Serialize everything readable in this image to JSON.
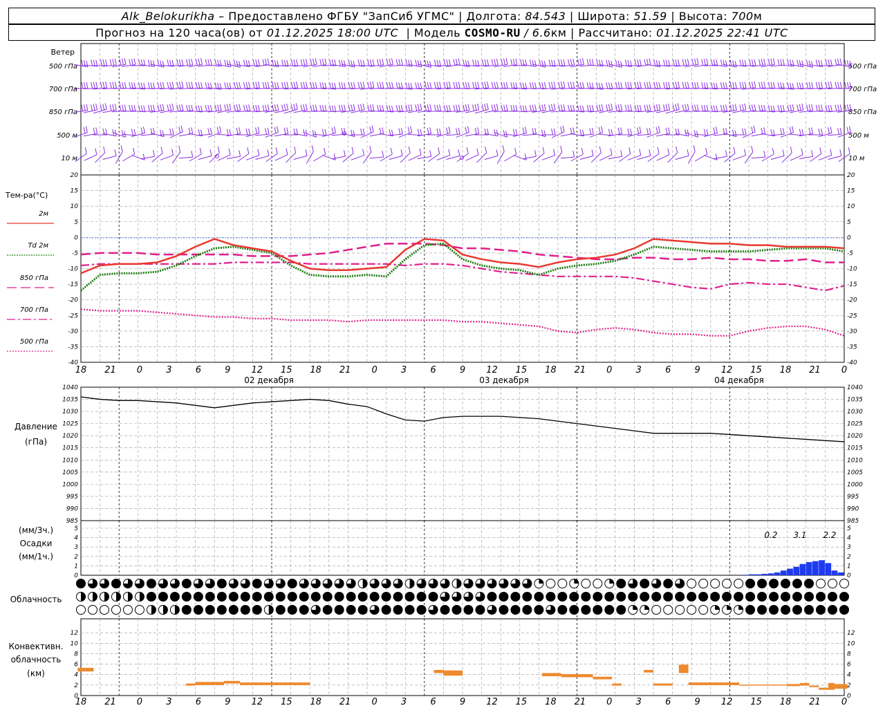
{
  "header": {
    "line1": {
      "station": "Alk_Belokurikha",
      "provider_text": " – Предоставлено ФГБУ \"ЗапСиб УГМС\" | Долгота: ",
      "lon": "84.543",
      "lat_label": " | Широта: ",
      "lat": "51.59",
      "alt_label": " | Высота: ",
      "alt": "700",
      "alt_unit": "м"
    },
    "line2": {
      "prefix": "Прогноз на 120 часа(ов) от ",
      "start": "01.12.2025 18:00 UTC",
      "model_label": "  | Модель ",
      "model": "COSMO-RU",
      "model_res": " / 6.6",
      "res_unit": "км",
      "calc_label": " | Рассчитано: ",
      "calc": "01.12.2025 22:41 UTC"
    }
  },
  "wind_panel": {
    "title": "Ветер",
    "levels": [
      "500 гПа",
      "700 гПа",
      "850 гПа",
      "500 м",
      "10 м"
    ],
    "color": "#8a2be2"
  },
  "time_axis": {
    "hour_labels": [
      "18",
      "21",
      "0",
      "3",
      "6",
      "9",
      "12",
      "15",
      "18",
      "21",
      "0",
      "3",
      "6",
      "9",
      "12",
      "15",
      "18",
      "21",
      "0",
      "3",
      "6",
      "9",
      "12",
      "15",
      "18",
      "21",
      "0"
    ],
    "day_labels": [
      "02 декабря",
      "03 декабря",
      "04 декабря"
    ]
  },
  "temp_panel": {
    "title": "Тем-ра(°C)",
    "legend": [
      {
        "label": "2м",
        "color": "#e8382f",
        "style": "solid"
      },
      {
        "label": "Td 2м",
        "color": "#1e7d12",
        "style": "dotted"
      },
      {
        "label": "850 гПа",
        "color": "#e01e8c",
        "style": "dash"
      },
      {
        "label": "700 гПа",
        "color": "#e01e8c",
        "style": "dashdot"
      },
      {
        "label": "500 гПа",
        "color": "#e01e8c",
        "style": "dot"
      }
    ],
    "y_ticks": [
      "20",
      "15",
      "10",
      "5",
      "0",
      "-5",
      "-10",
      "-15",
      "-20",
      "-25",
      "-30",
      "-35",
      "-40"
    ]
  },
  "pressure_panel": {
    "title": "Давление",
    "unit": "(гПа)",
    "y_ticks": [
      "1040",
      "1035",
      "1030",
      "1025",
      "1020",
      "1015",
      "1010",
      "1005",
      "1000",
      "995",
      "990",
      "985"
    ]
  },
  "precip_panel": {
    "unit3": "(мм/3ч.)",
    "title": "Осадки",
    "unit1": "(мм/1ч.)",
    "y_ticks": [
      "5",
      "4",
      "3",
      "2",
      "1",
      "0"
    ],
    "totals": [
      {
        "value": "0.2"
      },
      {
        "value": "3.1"
      },
      {
        "value": "2.2"
      }
    ],
    "color": "#1f3bf0"
  },
  "cloud_panel": {
    "title": "Облачность"
  },
  "conv_panel": {
    "title_line1": "Конвективн.",
    "title_line2": "облачность",
    "unit": "(км)",
    "y_ticks": [
      "12",
      "10",
      "8",
      "6",
      "4",
      "2",
      "0"
    ],
    "color": "#ee8a2e"
  },
  "chart_data": [
    {
      "type": "line",
      "title": "Тем-ра(°C)",
      "x_hours": [
        0,
        3,
        6,
        9,
        12,
        15,
        18,
        21,
        24,
        27,
        30,
        33,
        36,
        39,
        42,
        45,
        48,
        51,
        54,
        57,
        60,
        63,
        66,
        69,
        72,
        75,
        78,
        81,
        84,
        87,
        90,
        93,
        96,
        99,
        102,
        105,
        108,
        111,
        114,
        117,
        120
      ],
      "ylim": [
        -40,
        20
      ],
      "series": [
        {
          "name": "2м",
          "values": [
            -11.5,
            -9,
            -8.5,
            -8.5,
            -8,
            -6,
            -3,
            -0.5,
            -2.5,
            -3.5,
            -4.5,
            -7.5,
            -10,
            -10.5,
            -10.5,
            -10,
            -9.5,
            -4,
            -0.5,
            -1,
            -5.5,
            -7,
            -8,
            -8.5,
            -9.5,
            -8,
            -7,
            -6.5,
            -5.5,
            -3.5,
            -0.5,
            -1,
            -1.5,
            -2,
            -2,
            -2.5,
            -2.5,
            -3,
            -3,
            -3,
            -3.5
          ]
        },
        {
          "name": "Td 2м",
          "values": [
            -17,
            -12,
            -11.5,
            -11.5,
            -11,
            -9,
            -6,
            -3.5,
            -3,
            -4,
            -5,
            -9,
            -12,
            -12.5,
            -12.5,
            -12,
            -12.5,
            -7,
            -2.5,
            -2,
            -7,
            -9,
            -10,
            -10.5,
            -12,
            -10,
            -9,
            -8.5,
            -7.5,
            -5.5,
            -3,
            -3.5,
            -4,
            -4.5,
            -4.5,
            -4.5,
            -4,
            -3.5,
            -3.5,
            -3.5,
            -4.5
          ]
        },
        {
          "name": "850 гПа",
          "values": [
            -5.5,
            -5,
            -5,
            -5,
            -5.5,
            -5.5,
            -5.5,
            -5.5,
            -5.5,
            -6,
            -6,
            -6,
            -5.5,
            -5,
            -4,
            -3,
            -2,
            -2,
            -2,
            -2.5,
            -3.5,
            -3.5,
            -4,
            -4.5,
            -5.5,
            -6,
            -6.5,
            -7,
            -7,
            -6.5,
            -6.5,
            -7,
            -7,
            -6.5,
            -7,
            -7,
            -7.5,
            -7.5,
            -7,
            -8,
            -8
          ]
        },
        {
          "name": "700 гПа",
          "values": [
            -9,
            -8.5,
            -8.5,
            -8.5,
            -8.5,
            -8.5,
            -8.5,
            -8.5,
            -8,
            -8,
            -8,
            -8,
            -8.5,
            -8.5,
            -8.5,
            -8.5,
            -8.5,
            -9,
            -8.5,
            -8.5,
            -9,
            -10,
            -11,
            -11.5,
            -12,
            -12.5,
            -12.5,
            -12.5,
            -12.5,
            -13,
            -14,
            -15,
            -16,
            -16.5,
            -15,
            -14.5,
            -15,
            -15,
            -16,
            -17,
            -15.5
          ]
        },
        {
          "name": "500 гПа",
          "values": [
            -23,
            -23.5,
            -23.5,
            -23.5,
            -24,
            -24.5,
            -25,
            -25.5,
            -25.5,
            -26,
            -26,
            -26.5,
            -26.5,
            -26.5,
            -27,
            -26.5,
            -26.5,
            -26.5,
            -26.5,
            -26.5,
            -27,
            -27,
            -27.5,
            -28,
            -28.5,
            -30,
            -30.5,
            -29.5,
            -29,
            -29.5,
            -30.5,
            -31,
            -31,
            -31.5,
            -31.5,
            -30,
            -29,
            -28.5,
            -28.5,
            -29.5,
            -31.5
          ]
        }
      ]
    },
    {
      "type": "line",
      "title": "Давление",
      "ylabel": "(гПа)",
      "x_hours": [
        0,
        3,
        6,
        9,
        12,
        15,
        18,
        21,
        24,
        27,
        30,
        33,
        36,
        39,
        42,
        45,
        48,
        51,
        54,
        57,
        60,
        63,
        66,
        69,
        72,
        75,
        78,
        81,
        84,
        87,
        90,
        93,
        96,
        99,
        102,
        105,
        108,
        111,
        114,
        117,
        120
      ],
      "ylim": [
        985,
        1040
      ],
      "series": [
        {
          "name": "",
          "values": [
            1036,
            1035,
            1034.5,
            1034.5,
            1034,
            1033.5,
            1032.5,
            1031.5,
            1032.5,
            1033.5,
            1034,
            1034.5,
            1035,
            1034.5,
            1033,
            1032,
            1029,
            1026.5,
            1026,
            1027.5,
            1028,
            1028,
            1028,
            1027.5,
            1027,
            1026,
            1025,
            1024,
            1023,
            1022,
            1021,
            1021,
            1021,
            1021,
            1020.5,
            1020,
            1019.5,
            1019,
            1018.5,
            1018,
            1017.5
          ]
        }
      ]
    },
    {
      "type": "bar",
      "title": "Осадки",
      "ylabel": "(мм/1ч.)",
      "ylim": [
        0,
        5
      ],
      "x_hours": [
        104,
        105,
        106,
        107,
        108,
        109,
        110,
        111,
        112,
        113,
        114,
        115,
        116,
        117,
        118,
        119
      ],
      "values": [
        0.05,
        0.1,
        0.1,
        0.15,
        0.2,
        0.3,
        0.5,
        0.7,
        0.9,
        1.2,
        1.4,
        1.5,
        1.6,
        1.3,
        0.5,
        0.3
      ]
    },
    {
      "type": "bar",
      "title": "Конвективн. облачность",
      "ylabel": "(км)",
      "ylim": [
        0,
        14
      ],
      "segments": [
        {
          "x0": -0.5,
          "x1": 2,
          "bottom": 4.6,
          "top": 5.3
        },
        {
          "x0": 16.5,
          "x1": 18,
          "bottom": 1.9,
          "top": 2.3
        },
        {
          "x0": 18,
          "x1": 22.5,
          "bottom": 2,
          "top": 2.6
        },
        {
          "x0": 22.5,
          "x1": 25,
          "bottom": 2.3,
          "top": 2.8
        },
        {
          "x0": 25,
          "x1": 36,
          "bottom": 2,
          "top": 2.5
        },
        {
          "x0": 55.5,
          "x1": 57,
          "bottom": 4.3,
          "top": 4.9
        },
        {
          "x0": 57,
          "x1": 60,
          "bottom": 3.8,
          "top": 4.8
        },
        {
          "x0": 72.5,
          "x1": 75.5,
          "bottom": 3.7,
          "top": 4.3
        },
        {
          "x0": 75.5,
          "x1": 80.5,
          "bottom": 3.5,
          "top": 4.1
        },
        {
          "x0": 80.5,
          "x1": 83.5,
          "bottom": 3.1,
          "top": 3.6
        },
        {
          "x0": 83.5,
          "x1": 85,
          "bottom": 1.9,
          "top": 2.3
        },
        {
          "x0": 88.5,
          "x1": 90,
          "bottom": 4.4,
          "top": 4.9
        },
        {
          "x0": 90,
          "x1": 93,
          "bottom": 1.9,
          "top": 2.3
        },
        {
          "x0": 94,
          "x1": 95.5,
          "bottom": 4.3,
          "top": 5.9
        },
        {
          "x0": 95.5,
          "x1": 103.5,
          "bottom": 2,
          "top": 2.5
        },
        {
          "x0": 103.5,
          "x1": 111,
          "bottom": 1.9,
          "top": 2.1
        },
        {
          "x0": 111,
          "x1": 113,
          "bottom": 1.8,
          "top": 2.2
        },
        {
          "x0": 113,
          "x1": 114.5,
          "bottom": 1.9,
          "top": 2.4
        },
        {
          "x0": 114.5,
          "x1": 116,
          "bottom": 1.6,
          "top": 1.9
        },
        {
          "x0": 116,
          "x1": 117.5,
          "bottom": 1.1,
          "top": 1.5
        },
        {
          "x0": 117.5,
          "x1": 118.5,
          "bottom": 1.1,
          "top": 2.4
        },
        {
          "x0": 118.5,
          "x1": 120.5,
          "bottom": 1.3,
          "top": 2.2
        }
      ]
    }
  ]
}
